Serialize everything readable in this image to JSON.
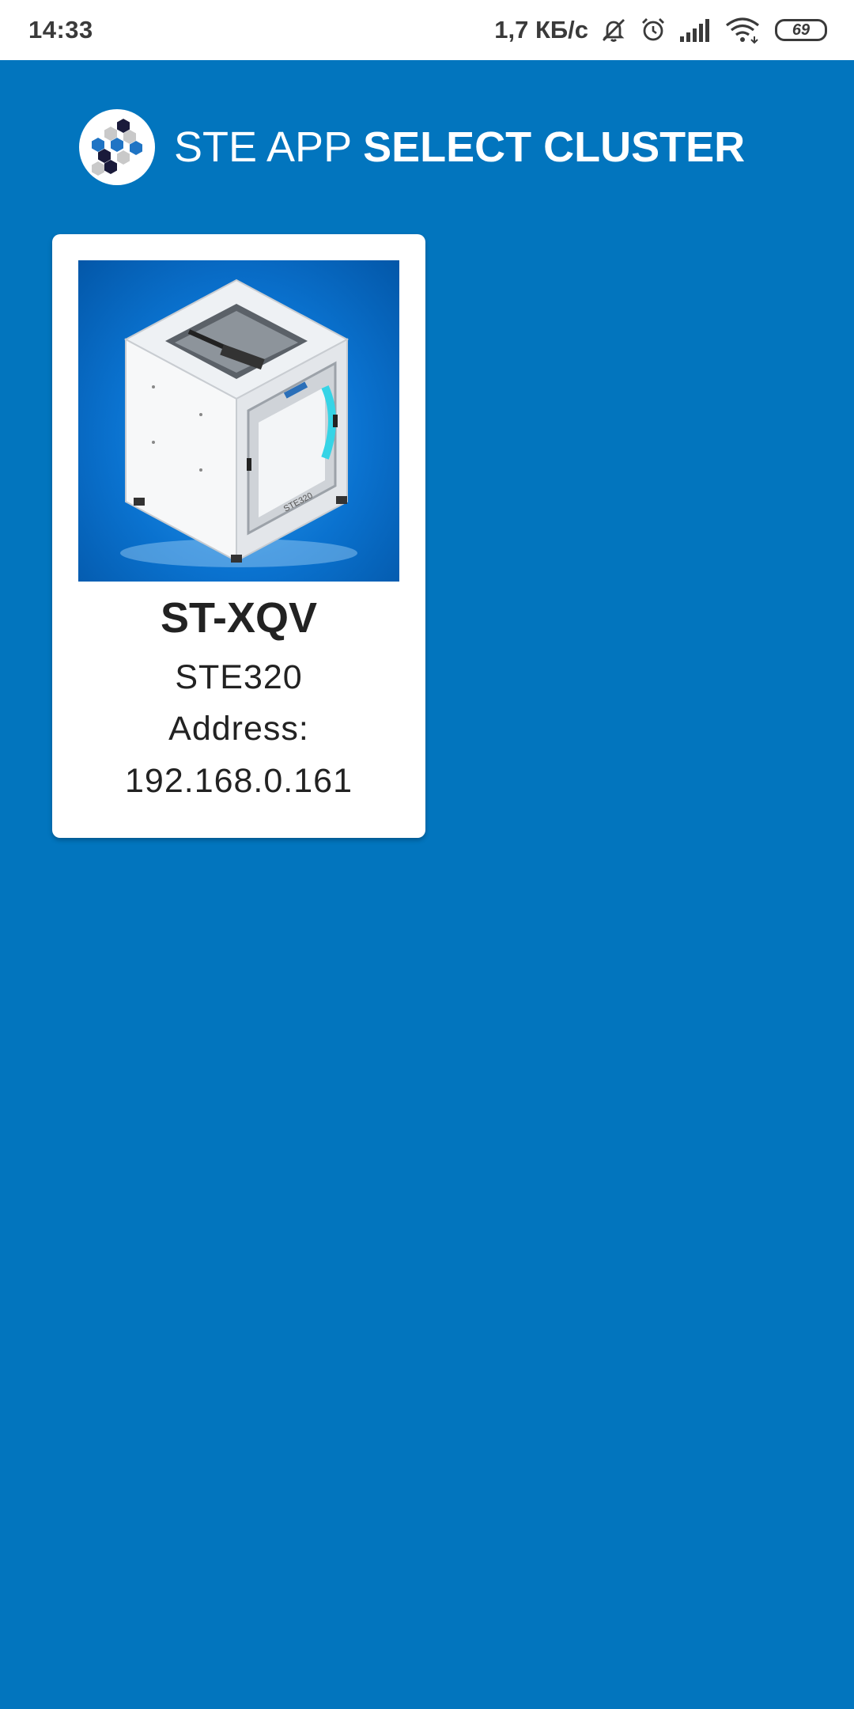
{
  "status_bar": {
    "time": "14:33",
    "network_speed": "1,7 КБ/с",
    "battery_level": "69",
    "icons": [
      "muted-bell-icon",
      "alarm-icon",
      "signal-icon",
      "wifi-icon",
      "battery-icon"
    ]
  },
  "header": {
    "app_name": "STE APP",
    "screen_title": "SELECT CLUSTER",
    "logo_icon": "hexagon-cluster-logo"
  },
  "colors": {
    "background": "#0275BE",
    "card": "#FFFFFF",
    "text_dark": "#222222"
  },
  "clusters": [
    {
      "name": "ST-XQV",
      "model": "STE320",
      "address_label": "Address:",
      "address": "192.168.0.161",
      "image": "3d-printer-image"
    }
  ]
}
